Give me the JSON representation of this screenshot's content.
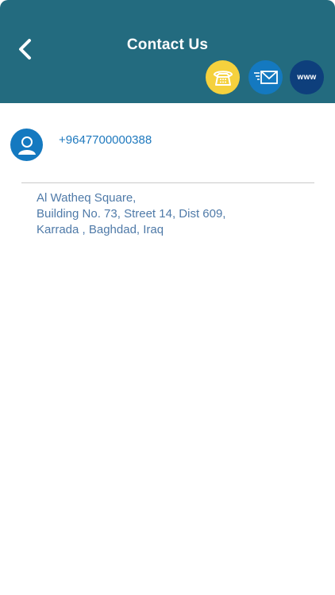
{
  "header": {
    "title": "Contact Us",
    "back_icon": "chevron-left-icon",
    "bg_color": "#236b7f",
    "actions": [
      {
        "name": "call",
        "icon": "telephone-icon",
        "color": "#f5d13d"
      },
      {
        "name": "email",
        "icon": "envelope-icon",
        "color": "#1479c0"
      },
      {
        "name": "website",
        "label": "www",
        "color": "#0e3f7c"
      }
    ]
  },
  "contact": {
    "avatar_icon": "person-icon",
    "phone": "+9647700000388",
    "address_lines": [
      "Al Watheq Square,",
      "Building No. 73, Street 14, Dist 609,",
      "Karrada , Baghdad, Iraq"
    ]
  }
}
